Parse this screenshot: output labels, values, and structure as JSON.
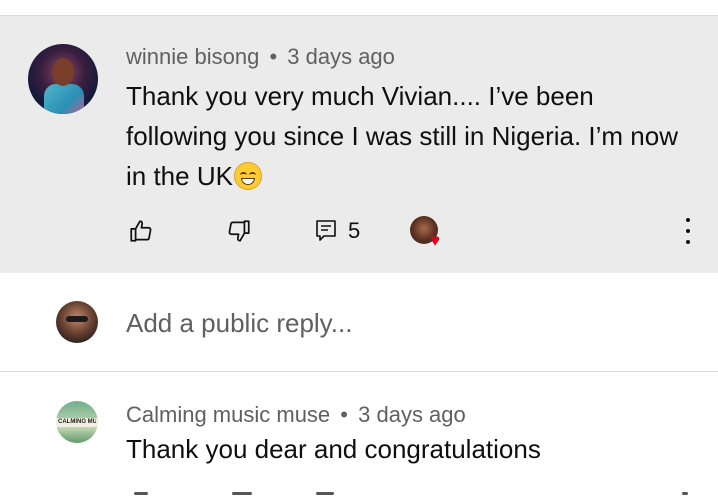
{
  "comment": {
    "author": "winnie bisong",
    "separator": "•",
    "time": "3 days ago",
    "text": "Thank you very much Vivian.... I’ve been following you since I was still in Nigeria. I’m now in the UK",
    "reply_count": "5",
    "creator_hearted": true
  },
  "reply_box": {
    "placeholder": "Add a public reply..."
  },
  "second_comment": {
    "author": "Calming music muse",
    "separator": "•",
    "time": "3 days ago",
    "text": "Thank you dear and congratulations",
    "avatar_text": "CALMING MUSIC"
  },
  "icons": {
    "like": "thumbs-up-icon",
    "dislike": "thumbs-down-icon",
    "replies": "comment-icon",
    "more": "more-vertical-icon",
    "heart": "heart-icon"
  },
  "colors": {
    "highlight_bg": "#ebebeb",
    "meta_text": "#606060",
    "heart": "#e3001b"
  }
}
